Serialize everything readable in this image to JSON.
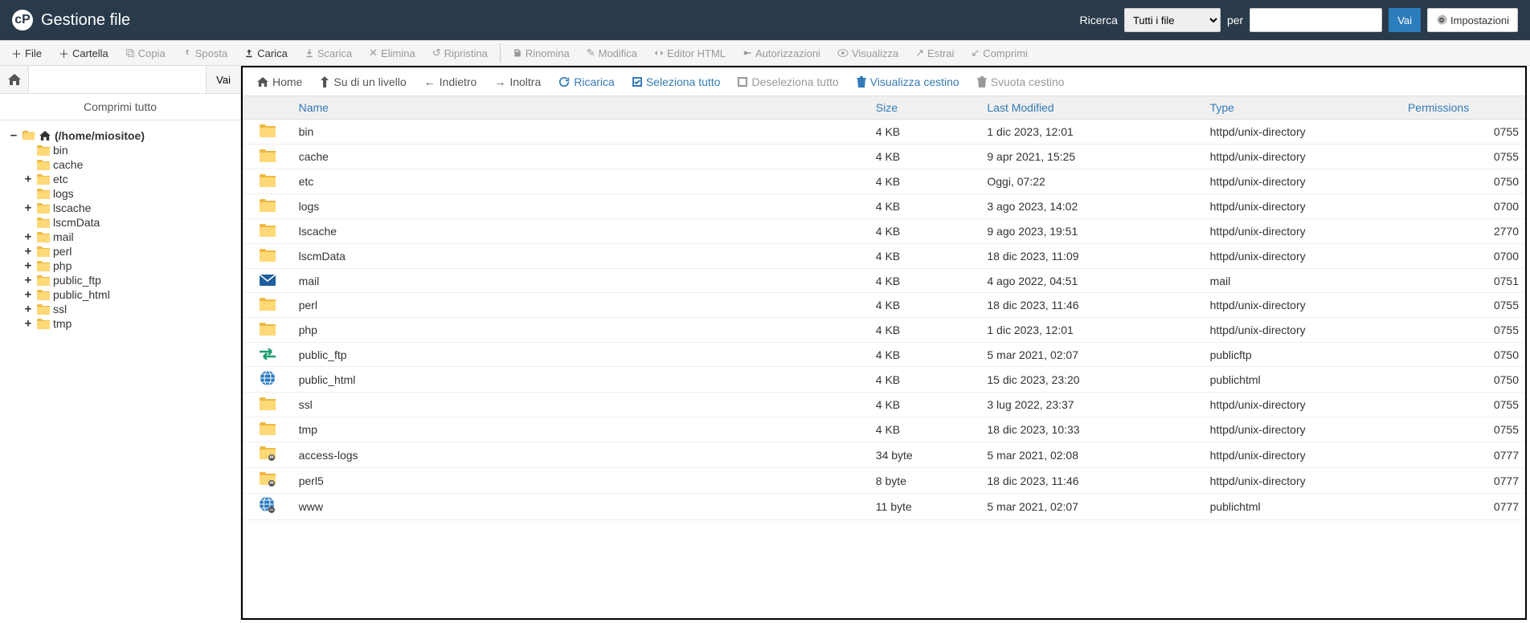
{
  "header": {
    "title": "Gestione file",
    "search_label": "Ricerca",
    "scope_selected": "Tutti i file",
    "for_label": "per",
    "go_button": "Vai",
    "settings_button": "Impostazioni"
  },
  "toolbar": {
    "file": "File",
    "folder": "Cartella",
    "copy": "Copia",
    "move": "Sposta",
    "upload": "Carica",
    "download": "Scarica",
    "delete": "Elimina",
    "restore": "Ripristina",
    "rename": "Rinomina",
    "edit": "Modifica",
    "html_editor": "Editor HTML",
    "permissions": "Autorizzazioni",
    "view": "Visualizza",
    "extract": "Estrai",
    "compress": "Comprimi"
  },
  "sidebar": {
    "go_button": "Vai",
    "collapse_all": "Comprimi tutto",
    "root_label": "(/home/miositoe)",
    "items": [
      {
        "label": "bin",
        "expand": null
      },
      {
        "label": "cache",
        "expand": null
      },
      {
        "label": "etc",
        "expand": "+"
      },
      {
        "label": "logs",
        "expand": null
      },
      {
        "label": "lscache",
        "expand": "+"
      },
      {
        "label": "lscmData",
        "expand": null
      },
      {
        "label": "mail",
        "expand": "+"
      },
      {
        "label": "perl",
        "expand": "+"
      },
      {
        "label": "php",
        "expand": "+"
      },
      {
        "label": "public_ftp",
        "expand": "+"
      },
      {
        "label": "public_html",
        "expand": "+"
      },
      {
        "label": "ssl",
        "expand": "+"
      },
      {
        "label": "tmp",
        "expand": "+"
      }
    ]
  },
  "navbar": {
    "home": "Home",
    "up": "Su di un livello",
    "back": "Indietro",
    "forward": "Inoltra",
    "reload": "Ricarica",
    "select_all": "Seleziona tutto",
    "deselect_all": "Deseleziona tutto",
    "view_trash": "Visualizza cestino",
    "empty_trash": "Svuota cestino"
  },
  "table": {
    "headers": {
      "name": "Name",
      "size": "Size",
      "modified": "Last Modified",
      "type": "Type",
      "permissions": "Permissions"
    },
    "rows": [
      {
        "icon": "folder",
        "name": "bin",
        "size": "4 KB",
        "modified": "1 dic 2023, 12:01",
        "type": "httpd/unix-directory",
        "perm": "0755"
      },
      {
        "icon": "folder",
        "name": "cache",
        "size": "4 KB",
        "modified": "9 apr 2021, 15:25",
        "type": "httpd/unix-directory",
        "perm": "0755"
      },
      {
        "icon": "folder",
        "name": "etc",
        "size": "4 KB",
        "modified": "Oggi, 07:22",
        "type": "httpd/unix-directory",
        "perm": "0750"
      },
      {
        "icon": "folder",
        "name": "logs",
        "size": "4 KB",
        "modified": "3 ago 2023, 14:02",
        "type": "httpd/unix-directory",
        "perm": "0700"
      },
      {
        "icon": "folder",
        "name": "lscache",
        "size": "4 KB",
        "modified": "9 ago 2023, 19:51",
        "type": "httpd/unix-directory",
        "perm": "2770"
      },
      {
        "icon": "folder",
        "name": "lscmData",
        "size": "4 KB",
        "modified": "18 dic 2023, 11:09",
        "type": "httpd/unix-directory",
        "perm": "0700"
      },
      {
        "icon": "mail",
        "name": "mail",
        "size": "4 KB",
        "modified": "4 ago 2022, 04:51",
        "type": "mail",
        "perm": "0751"
      },
      {
        "icon": "folder",
        "name": "perl",
        "size": "4 KB",
        "modified": "18 dic 2023, 11:46",
        "type": "httpd/unix-directory",
        "perm": "0755"
      },
      {
        "icon": "folder",
        "name": "php",
        "size": "4 KB",
        "modified": "1 dic 2023, 12:01",
        "type": "httpd/unix-directory",
        "perm": "0755"
      },
      {
        "icon": "ftp",
        "name": "public_ftp",
        "size": "4 KB",
        "modified": "5 mar 2021, 02:07",
        "type": "publicftp",
        "perm": "0750"
      },
      {
        "icon": "globe",
        "name": "public_html",
        "size": "4 KB",
        "modified": "15 dic 2023, 23:20",
        "type": "publichtml",
        "perm": "0750"
      },
      {
        "icon": "folder",
        "name": "ssl",
        "size": "4 KB",
        "modified": "3 lug 2022, 23:37",
        "type": "httpd/unix-directory",
        "perm": "0755"
      },
      {
        "icon": "folder",
        "name": "tmp",
        "size": "4 KB",
        "modified": "18 dic 2023, 10:33",
        "type": "httpd/unix-directory",
        "perm": "0755"
      },
      {
        "icon": "folder-link",
        "name": "access-logs",
        "size": "34 byte",
        "modified": "5 mar 2021, 02:08",
        "type": "httpd/unix-directory",
        "perm": "0777"
      },
      {
        "icon": "folder-link",
        "name": "perl5",
        "size": "8 byte",
        "modified": "18 dic 2023, 11:46",
        "type": "httpd/unix-directory",
        "perm": "0777"
      },
      {
        "icon": "globe-link",
        "name": "www",
        "size": "11 byte",
        "modified": "5 mar 2021, 02:07",
        "type": "publichtml",
        "perm": "0777"
      }
    ]
  }
}
